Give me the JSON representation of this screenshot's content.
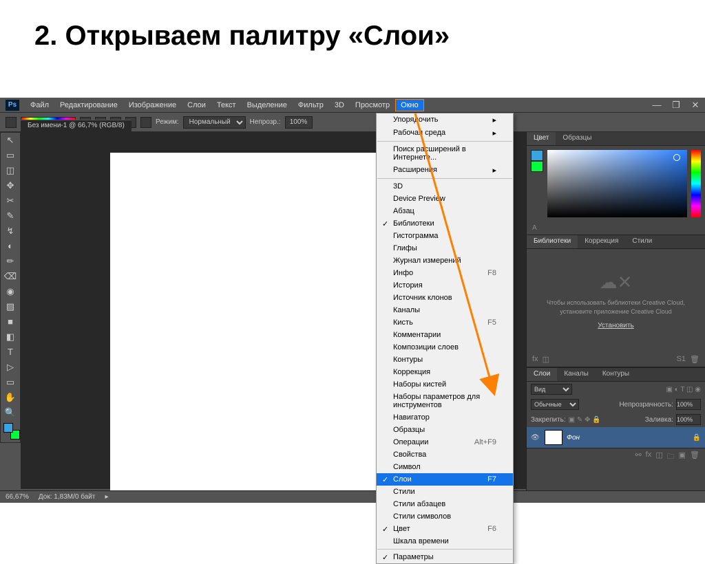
{
  "slide_title": "2. Открываем палитру «Слои»",
  "menu": {
    "items": [
      "Файл",
      "Редактирование",
      "Изображение",
      "Слои",
      "Текст",
      "Выделение",
      "Фильтр",
      "3D",
      "Просмотр",
      "Окно"
    ],
    "active": "Окно"
  },
  "doc_tab": "Без имени-1 @ 66,7% (RGB/8)",
  "optbar": {
    "mode_label": "Режим:",
    "mode_value": "Нормальный",
    "opacity_label": "Непрозр.:",
    "opacity_value": "100%"
  },
  "dropdown": [
    {
      "label": "Упорядочить",
      "arrow": true
    },
    {
      "label": "Рабочая среда",
      "arrow": true
    },
    {
      "sep": true
    },
    {
      "label": "Поиск расширений в Интернете..."
    },
    {
      "label": "Расширения",
      "arrow": true
    },
    {
      "sep": true
    },
    {
      "label": "3D"
    },
    {
      "label": "Device Preview"
    },
    {
      "label": "Абзац"
    },
    {
      "label": "Библиотеки",
      "check": true
    },
    {
      "label": "Гистограмма"
    },
    {
      "label": "Глифы"
    },
    {
      "label": "Журнал измерений"
    },
    {
      "label": "Инфо",
      "shortcut": "F8"
    },
    {
      "label": "История"
    },
    {
      "label": "Источник клонов"
    },
    {
      "label": "Каналы"
    },
    {
      "label": "Кисть",
      "shortcut": "F5"
    },
    {
      "label": "Комментарии"
    },
    {
      "label": "Композиции слоев"
    },
    {
      "label": "Контуры"
    },
    {
      "label": "Коррекция"
    },
    {
      "label": "Наборы кистей"
    },
    {
      "label": "Наборы параметров для инструментов"
    },
    {
      "label": "Навигатор"
    },
    {
      "label": "Образцы"
    },
    {
      "label": "Операции",
      "shortcut": "Alt+F9"
    },
    {
      "label": "Свойства"
    },
    {
      "label": "Символ"
    },
    {
      "label": "Слои",
      "shortcut": "F7",
      "check": true,
      "sel": true
    },
    {
      "label": "Стили"
    },
    {
      "label": "Стили абзацев"
    },
    {
      "label": "Стили символов"
    },
    {
      "label": "Цвет",
      "shortcut": "F6",
      "check": true
    },
    {
      "label": "Шкала времени"
    },
    {
      "sep": true
    },
    {
      "label": "Параметры",
      "check": true
    }
  ],
  "color_tabs": [
    "Цвет",
    "Образцы"
  ],
  "lib_tabs": [
    "Библиотеки",
    "Коррекция",
    "Стили"
  ],
  "lib_msg": "Чтобы использовать библиотеки Creative Cloud, установите приложение Creative Cloud",
  "lib_link": "Установить",
  "layers_tabs": [
    "Слои",
    "Каналы",
    "Контуры"
  ],
  "layers": {
    "kind": "Вид",
    "blend": "Обычные",
    "opacity_label": "Непрозрачность:",
    "opacity": "100%",
    "lock_label": "Закрепить:",
    "fill_label": "Заливка:",
    "fill": "100%",
    "layer_name": "Фон"
  },
  "status": {
    "zoom": "66,67%",
    "doc": "Док: 1,83M/0 байт"
  },
  "tools": [
    "↖",
    "▭",
    "◫",
    "✥",
    "✂",
    "✎",
    "↯",
    "◐",
    "✏",
    "⌫",
    "◉",
    "▨",
    "■",
    "◧",
    "✎",
    "T",
    "▷",
    "▭",
    "✋",
    "🔍"
  ]
}
